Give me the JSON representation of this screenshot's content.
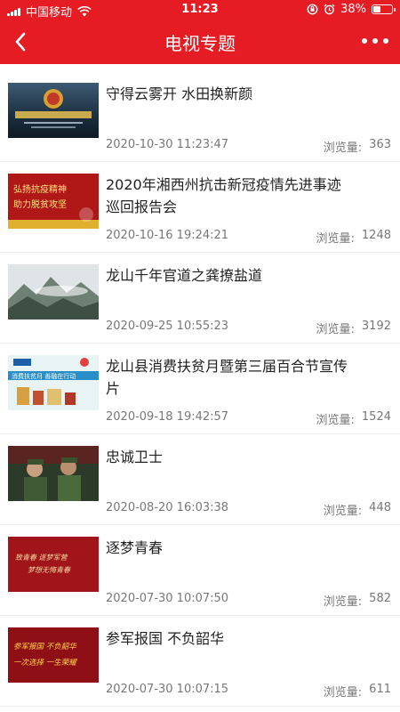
{
  "status_bar": {
    "carrier": "中国移动",
    "time": "11:23",
    "battery": "38%",
    "battery_level": 0.38
  },
  "header": {
    "title": "电视专题",
    "back_icon": "chevron-left-icon",
    "more_icon": "more-dots-icon"
  },
  "view_label": "浏览量:",
  "items": [
    {
      "title": "守得云雾开 水田换新颜",
      "date": "2020-10-30 11:23:47",
      "views": "363"
    },
    {
      "title": "2020年湘西州抗击新冠疫情先进事迹巡回报告会",
      "date": "2020-10-16 19:24:21",
      "views": "1248"
    },
    {
      "title": "龙山千年官道之龚撩盐道",
      "date": "2020-09-25 10:55:23",
      "views": "3192"
    },
    {
      "title": "龙山县消费扶贫月暨第三届百合节宣传片",
      "date": "2020-09-18 19:42:57",
      "views": "1524"
    },
    {
      "title": "忠诚卫士",
      "date": "2020-08-20 16:03:38",
      "views": "448"
    },
    {
      "title": "逐梦青春",
      "date": "2020-07-30 10:07:50",
      "views": "582"
    },
    {
      "title": "参军报国 不负韶华",
      "date": "2020-07-30 10:07:15",
      "views": "611"
    }
  ],
  "thumb_text": {
    "item2_line1": "弘扬抗疫精神",
    "item2_line2": "助力脱贫攻坚",
    "item4_banner": "消费扶贫月 善融在行动",
    "item6_line1": "致青春 逐梦军营",
    "item6_line2": "梦想无悔青春",
    "item7_line1": "参军报国 不负韶华",
    "item7_line2": "一次选择 一生荣耀"
  }
}
